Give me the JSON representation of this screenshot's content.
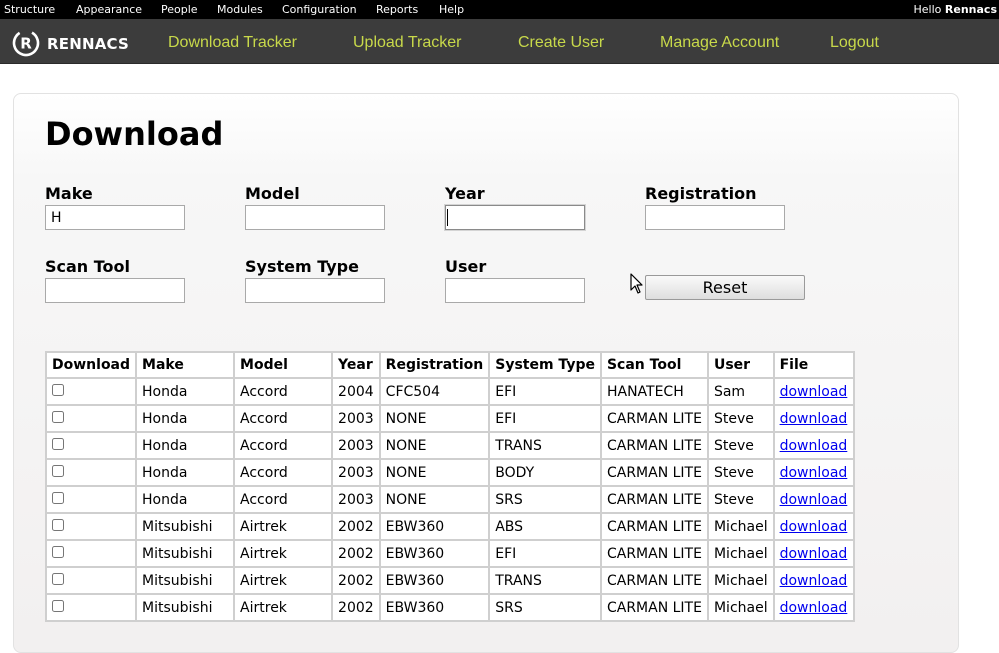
{
  "admin_menu": {
    "items": [
      "Structure",
      "Appearance",
      "People",
      "Modules",
      "Configuration",
      "Reports",
      "Help"
    ],
    "hello_prefix": "Hello",
    "username": "Rennacs"
  },
  "header": {
    "logo_letter": "R",
    "brand": "RENNACS",
    "nav": [
      "Download Tracker",
      "Upload Tracker",
      "Create User",
      "Manage Account",
      "Logout"
    ],
    "nav_color": "#c8d94a"
  },
  "page": {
    "title": "Download"
  },
  "filters": {
    "make": {
      "label": "Make",
      "value": "H"
    },
    "model": {
      "label": "Model",
      "value": ""
    },
    "year": {
      "label": "Year",
      "value": ""
    },
    "registration": {
      "label": "Registration",
      "value": ""
    },
    "scan_tool": {
      "label": "Scan Tool",
      "value": ""
    },
    "system_type": {
      "label": "System Type",
      "value": ""
    },
    "user": {
      "label": "User",
      "value": ""
    },
    "reset_label": "Reset"
  },
  "table": {
    "headers": [
      "Download",
      "Make",
      "Model",
      "Year",
      "Registration",
      "System Type",
      "Scan Tool",
      "User",
      "File"
    ],
    "rows": [
      {
        "make": "Honda",
        "model": "Accord",
        "year": "2004",
        "registration": "CFC504",
        "system_type": "EFI",
        "scan_tool": "HANATECH",
        "user": "Sam",
        "file": "download"
      },
      {
        "make": "Honda",
        "model": "Accord",
        "year": "2003",
        "registration": "NONE",
        "system_type": "EFI",
        "scan_tool": "CARMAN LITE",
        "user": "Steve",
        "file": "download"
      },
      {
        "make": "Honda",
        "model": "Accord",
        "year": "2003",
        "registration": "NONE",
        "system_type": "TRANS",
        "scan_tool": "CARMAN LITE",
        "user": "Steve",
        "file": "download"
      },
      {
        "make": "Honda",
        "model": "Accord",
        "year": "2003",
        "registration": "NONE",
        "system_type": "BODY",
        "scan_tool": "CARMAN LITE",
        "user": "Steve",
        "file": "download"
      },
      {
        "make": "Honda",
        "model": "Accord",
        "year": "2003",
        "registration": "NONE",
        "system_type": "SRS",
        "scan_tool": "CARMAN LITE",
        "user": "Steve",
        "file": "download"
      },
      {
        "make": "Mitsubishi",
        "model": "Airtrek",
        "year": "2002",
        "registration": "EBW360",
        "system_type": "ABS",
        "scan_tool": "CARMAN LITE",
        "user": "Michael",
        "file": "download"
      },
      {
        "make": "Mitsubishi",
        "model": "Airtrek",
        "year": "2002",
        "registration": "EBW360",
        "system_type": "EFI",
        "scan_tool": "CARMAN LITE",
        "user": "Michael",
        "file": "download"
      },
      {
        "make": "Mitsubishi",
        "model": "Airtrek",
        "year": "2002",
        "registration": "EBW360",
        "system_type": "TRANS",
        "scan_tool": "CARMAN LITE",
        "user": "Michael",
        "file": "download"
      },
      {
        "make": "Mitsubishi",
        "model": "Airtrek",
        "year": "2002",
        "registration": "EBW360",
        "system_type": "SRS",
        "scan_tool": "CARMAN LITE",
        "user": "Michael",
        "file": "download"
      }
    ]
  }
}
